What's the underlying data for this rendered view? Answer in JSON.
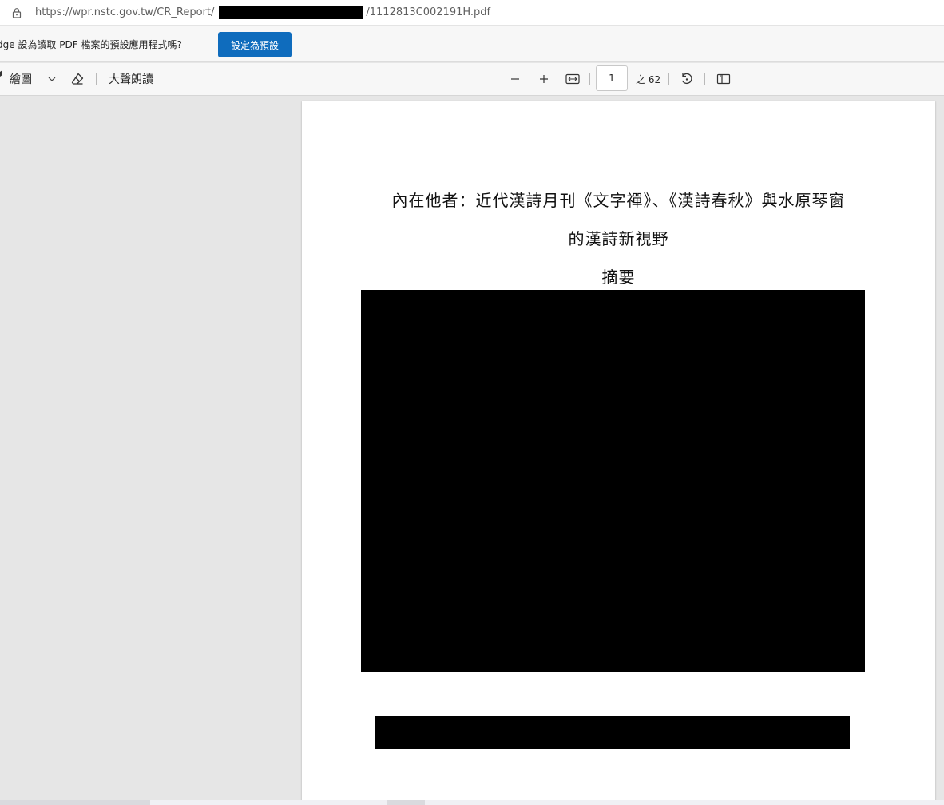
{
  "address_bar": {
    "url_prefix": "https://wpr.nstc.gov.tw/CR_Report/",
    "url_suffix": "/1112813C002191H.pdf"
  },
  "notification": {
    "text": "dge 設為讀取 PDF 檔案的預設應用程式嗎?",
    "button_label": "設定為預設"
  },
  "toolbar": {
    "draw_label": "繪圖",
    "read_aloud_label": "大聲朗讀",
    "current_page": "1",
    "page_total": "之 62"
  },
  "document": {
    "title_line1": "內在他者：近代漢詩月刊《文字禪》、《漢詩春秋》與水原琴窗",
    "title_line2": "的漢詩新視野",
    "heading": "摘要"
  }
}
